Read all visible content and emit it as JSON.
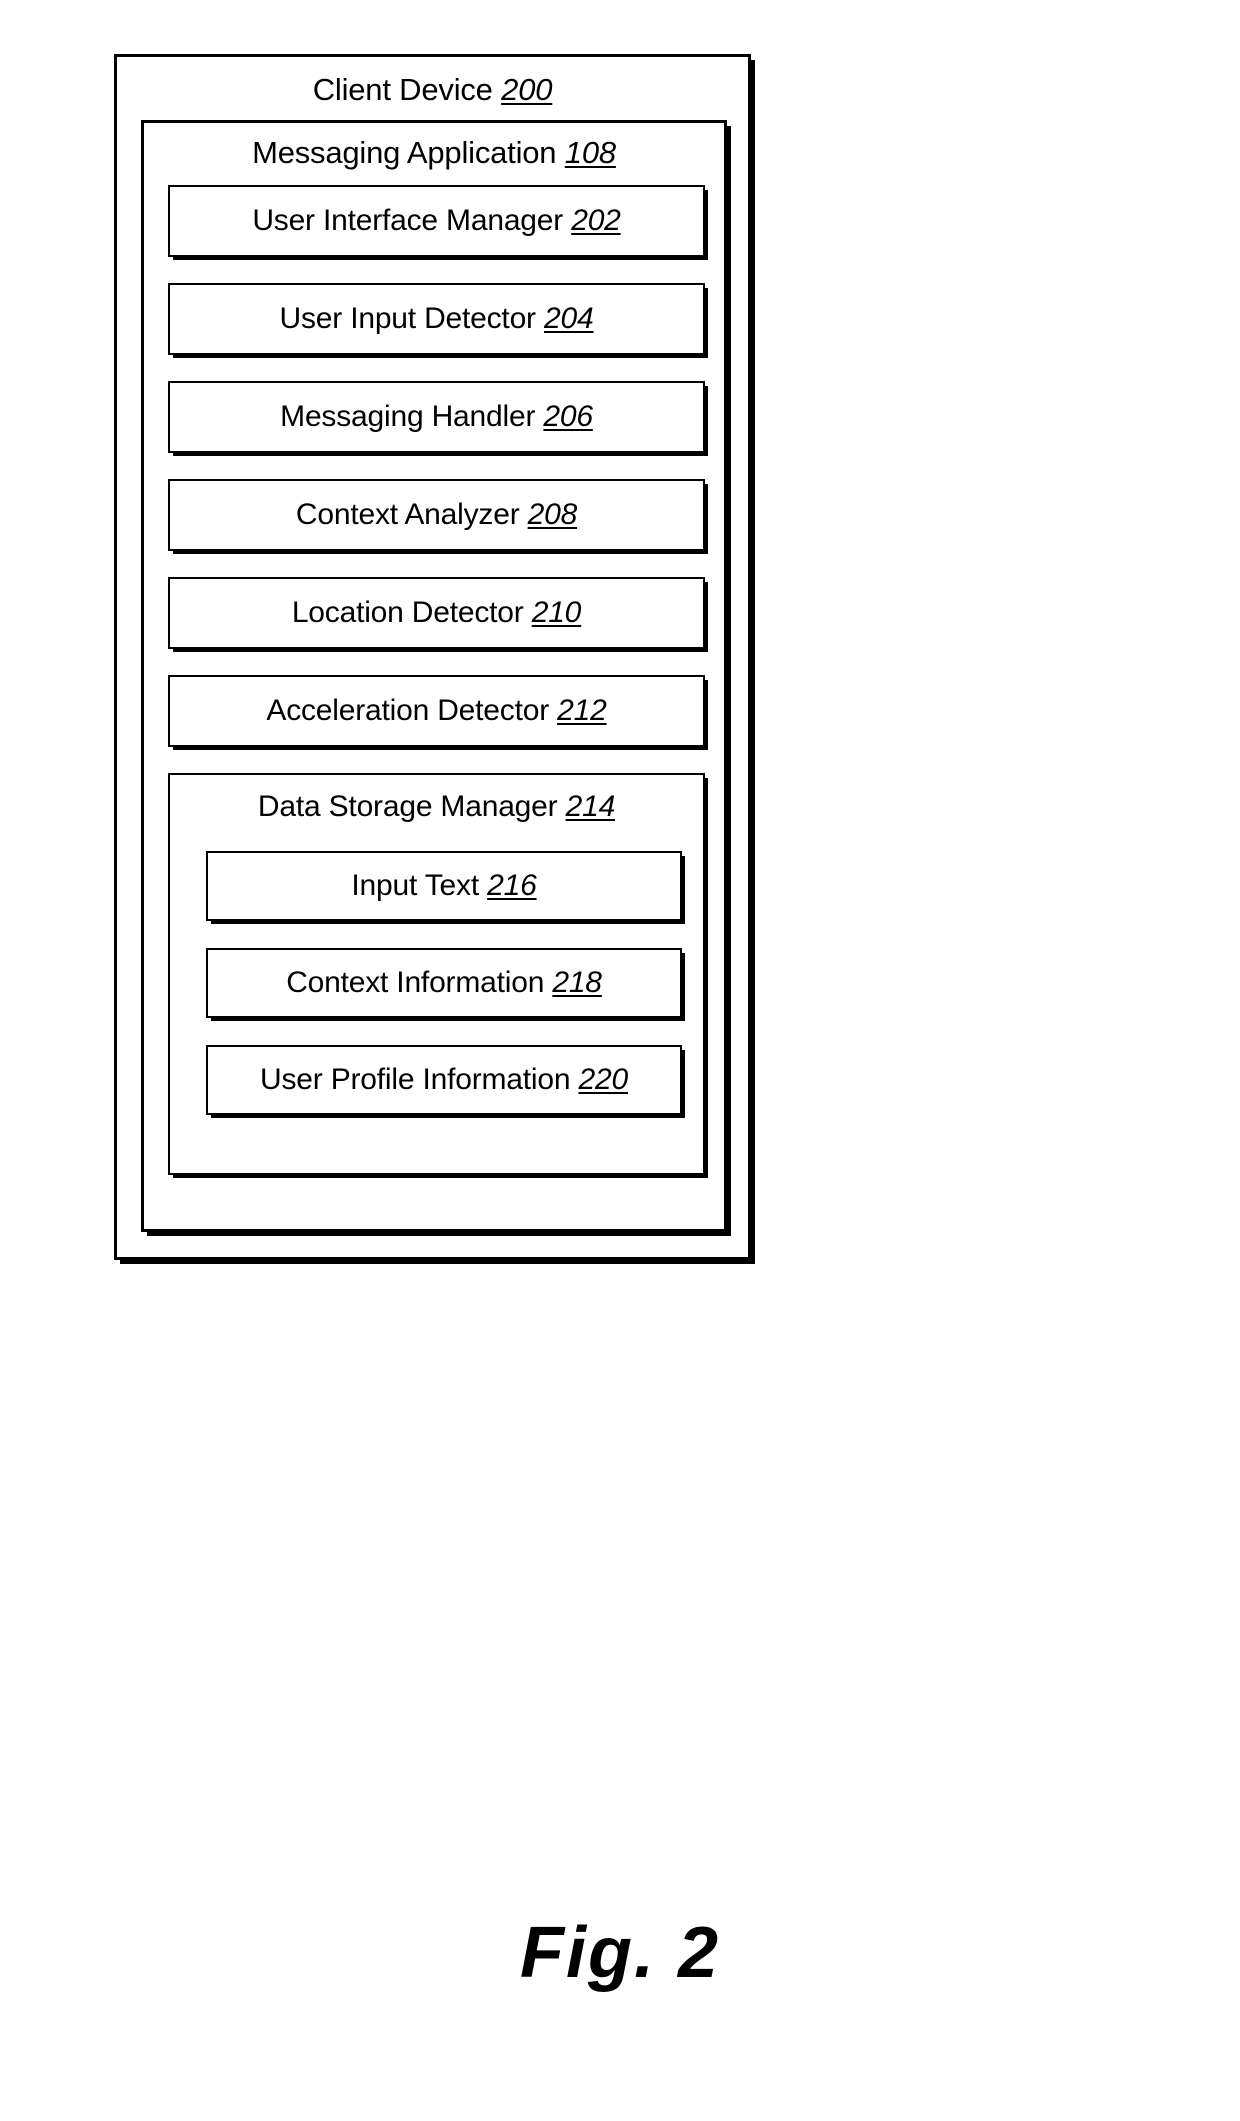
{
  "figure": {
    "caption": "Fig. 2",
    "type": "patent-block-diagram"
  },
  "client_device": {
    "title": "Client Device",
    "ref": "200"
  },
  "messaging_application": {
    "title": "Messaging Application",
    "ref": "108"
  },
  "components": [
    {
      "title": "User Interface Manager",
      "ref": "202"
    },
    {
      "title": "User Input Detector",
      "ref": "204"
    },
    {
      "title": "Messaging Handler",
      "ref": "206"
    },
    {
      "title": "Context Analyzer",
      "ref": "208"
    },
    {
      "title": "Location Detector",
      "ref": "210"
    },
    {
      "title": "Acceleration Detector",
      "ref": "212"
    }
  ],
  "data_storage_manager": {
    "title": "Data Storage Manager",
    "ref": "214",
    "items": [
      {
        "title": "Input Text",
        "ref": "216"
      },
      {
        "title": "Context Information",
        "ref": "218"
      },
      {
        "title": "User Profile Information",
        "ref": "220"
      }
    ]
  },
  "colors": {
    "stroke": "#000000",
    "background": "#ffffff"
  }
}
